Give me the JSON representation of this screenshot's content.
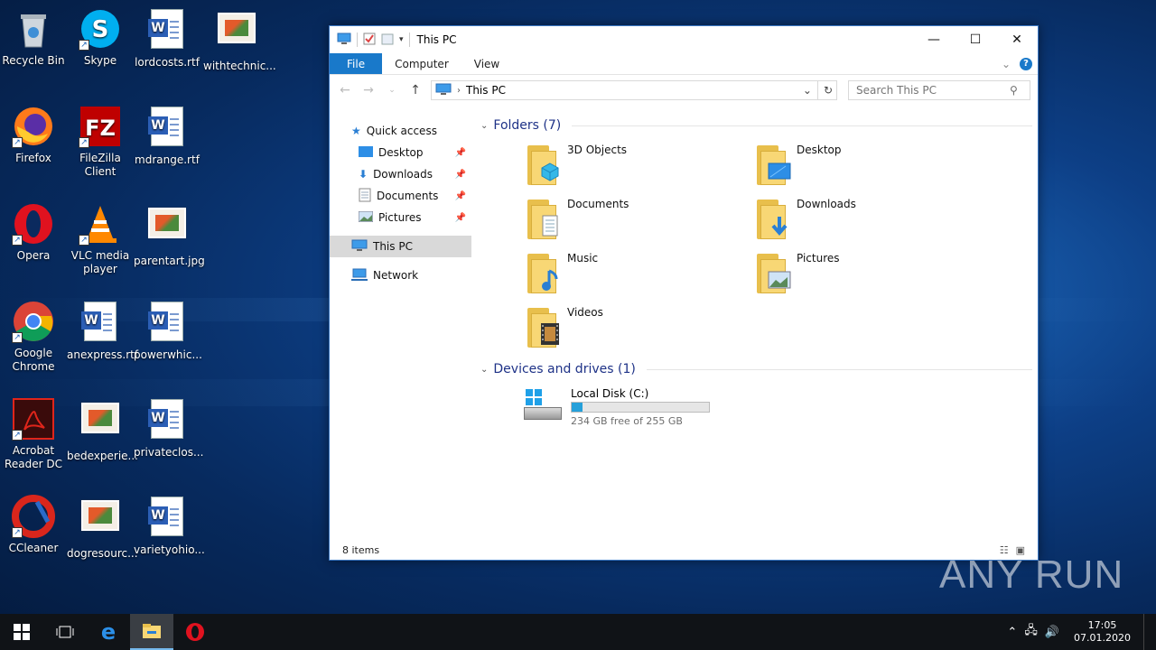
{
  "desktop": {
    "icons": [
      {
        "label": "Recycle Bin"
      },
      {
        "label": "Skype"
      },
      {
        "label": "lordcosts.rtf"
      },
      {
        "label": "withtechnic..."
      },
      {
        "label": "Firefox"
      },
      {
        "label": "FileZilla Client"
      },
      {
        "label": "mdrange.rtf"
      },
      {
        "label": "Opera"
      },
      {
        "label": "VLC media player"
      },
      {
        "label": "parentart.jpg"
      },
      {
        "label": "Google Chrome"
      },
      {
        "label": "anexpress.rtf"
      },
      {
        "label": "powerwhic..."
      },
      {
        "label": "Acrobat Reader DC"
      },
      {
        "label": "bedexperie..."
      },
      {
        "label": "privateclos..."
      },
      {
        "label": "CCleaner"
      },
      {
        "label": "dogresourc..."
      },
      {
        "label": "varietyohio..."
      }
    ]
  },
  "window": {
    "title": "This PC",
    "tabs": {
      "file": "File",
      "computer": "Computer",
      "view": "View"
    },
    "address": "This PC",
    "search_placeholder": "Search This PC",
    "nav": {
      "quick_access": "Quick access",
      "desktop": "Desktop",
      "downloads": "Downloads",
      "documents": "Documents",
      "pictures": "Pictures",
      "this_pc": "This PC",
      "network": "Network"
    },
    "folders_header": "Folders (7)",
    "folders": [
      {
        "label": "3D Objects"
      },
      {
        "label": "Desktop"
      },
      {
        "label": "Documents"
      },
      {
        "label": "Downloads"
      },
      {
        "label": "Music"
      },
      {
        "label": "Pictures"
      },
      {
        "label": "Videos"
      }
    ],
    "devices_header": "Devices and drives (1)",
    "drive": {
      "label": "Local Disk (C:)",
      "free_text": "234 GB free of 255 GB",
      "used_fraction": 0.082
    },
    "status": "8 items"
  },
  "taskbar": {
    "time": "17:05",
    "date": "07.01.2020"
  },
  "watermark": "ANY RUN"
}
